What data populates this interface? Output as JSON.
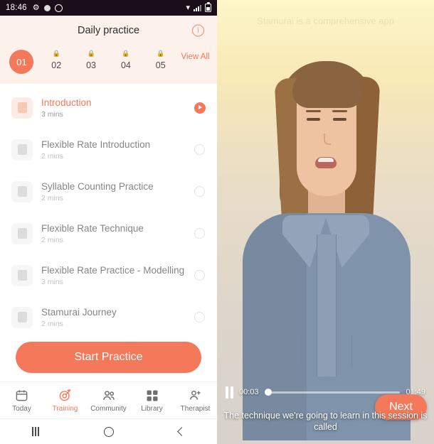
{
  "status_bar": {
    "time": "18:46",
    "icons_left": [
      "gear-icon",
      "dot-icon",
      "google-icon"
    ],
    "icons_right": [
      "wifi-icon",
      "signal-icon",
      "battery-icon"
    ]
  },
  "header": {
    "title": "Daily practice",
    "info_label": "i"
  },
  "steps": {
    "items": [
      {
        "num": "01",
        "locked": false,
        "active": true
      },
      {
        "num": "02",
        "locked": true,
        "active": false
      },
      {
        "num": "03",
        "locked": true,
        "active": false
      },
      {
        "num": "04",
        "locked": true,
        "active": false
      },
      {
        "num": "05",
        "locked": true,
        "active": false
      }
    ],
    "view_all": "View All",
    "lock_glyph": "🔒"
  },
  "lessons": [
    {
      "title": "Introduction",
      "duration": "3 mins",
      "state": "current",
      "action": "play"
    },
    {
      "title": "Flexible Rate Introduction",
      "duration": "2 mins",
      "state": "locked",
      "action": "circle"
    },
    {
      "title": "Syllable Counting Practice",
      "duration": "2 mins",
      "state": "locked",
      "action": "circle"
    },
    {
      "title": "Flexible Rate Technique",
      "duration": "2 mins",
      "state": "locked",
      "action": "circle"
    },
    {
      "title": "Flexible Rate Practice - Modelling",
      "duration": "3 mins",
      "state": "locked",
      "action": "circle"
    },
    {
      "title": "Stamurai Journey",
      "duration": "2 mins",
      "state": "locked",
      "action": "circle"
    }
  ],
  "cta": {
    "label": "Start Practice"
  },
  "tabbar": {
    "items": [
      {
        "label": "Today",
        "icon": "calendar-icon",
        "active": false
      },
      {
        "label": "Training",
        "icon": "target-icon",
        "active": true
      },
      {
        "label": "Community",
        "icon": "people-icon",
        "active": false
      },
      {
        "label": "Library",
        "icon": "grid-icon",
        "active": false
      },
      {
        "label": "Therapist",
        "icon": "person-add-icon",
        "active": false
      }
    ]
  },
  "navbar": {
    "recents": "recents-icon",
    "home": "home-icon",
    "back": "back-icon"
  },
  "video": {
    "ghost_title": "Stamurai is a comprehensive app",
    "current_time": "00:03",
    "total_time": "01:49",
    "progress_percent": 2.8,
    "pause_label": "pause-icon",
    "next_label": "Next",
    "caption": "The technique we're going to learn in this session is called"
  },
  "colors": {
    "accent": "#f4795b",
    "header_bg": "#fdf1ec",
    "status_bar_bg": "#1b0d1a",
    "muted_text": "#9a9a9a"
  }
}
